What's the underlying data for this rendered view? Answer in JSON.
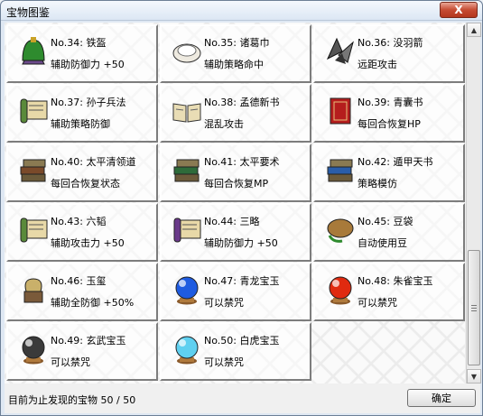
{
  "window": {
    "title": "宝物图鉴",
    "close_label": "X"
  },
  "items": [
    {
      "name": "No.34: 铁盔",
      "desc": "辅助防御力 +50",
      "icon": "helmet-icon"
    },
    {
      "name": "No.35: 诸葛巾",
      "desc": "辅助策略命中",
      "icon": "headscarf-icon"
    },
    {
      "name": "No.36: 没羽箭",
      "desc": "远距攻击",
      "icon": "arrowhead-icon"
    },
    {
      "name": "No.37: 孙子兵法",
      "desc": "辅助策略防御",
      "icon": "scroll-icon"
    },
    {
      "name": "No.38: 孟德新书",
      "desc": "混乱攻击",
      "icon": "open-book-icon"
    },
    {
      "name": "No.39: 青囊书",
      "desc": "每回合恢复HP",
      "icon": "red-book-icon"
    },
    {
      "name": "No.40: 太平清领道",
      "desc": "每回合恢复状态",
      "icon": "book-stack-icon"
    },
    {
      "name": "No.41: 太平要术",
      "desc": "每回合恢复MP",
      "icon": "green-books-icon"
    },
    {
      "name": "No.42: 遁甲天书",
      "desc": "策略模仿",
      "icon": "blue-books-icon"
    },
    {
      "name": "No.43: 六韬",
      "desc": "辅助攻击力 +50",
      "icon": "scroll-icon"
    },
    {
      "name": "No.44: 三略",
      "desc": "辅助防御力 +50",
      "icon": "purple-scroll-icon"
    },
    {
      "name": "No.45: 豆袋",
      "desc": "自动使用豆",
      "icon": "bean-bag-icon"
    },
    {
      "name": "No.46: 玉玺",
      "desc": "辅助全防御 +50%",
      "icon": "jade-seal-icon"
    },
    {
      "name": "No.47: 青龙宝玉",
      "desc": "可以禁咒",
      "icon": "blue-orb-icon"
    },
    {
      "name": "No.48: 朱雀宝玉",
      "desc": "可以禁咒",
      "icon": "red-orb-icon"
    },
    {
      "name": "No.49: 玄武宝玉",
      "desc": "可以禁咒",
      "icon": "black-orb-icon"
    },
    {
      "name": "No.50: 白虎宝玉",
      "desc": "可以禁咒",
      "icon": "white-orb-icon"
    }
  ],
  "footer": {
    "found_text": "目前为止发现的宝物 50 / 50",
    "ok_label": "确定"
  },
  "colors": {
    "orb_blue": "#1e5be0",
    "orb_red": "#e02a10",
    "orb_black": "#3a3a3a",
    "orb_white": "#5fd0f0"
  }
}
